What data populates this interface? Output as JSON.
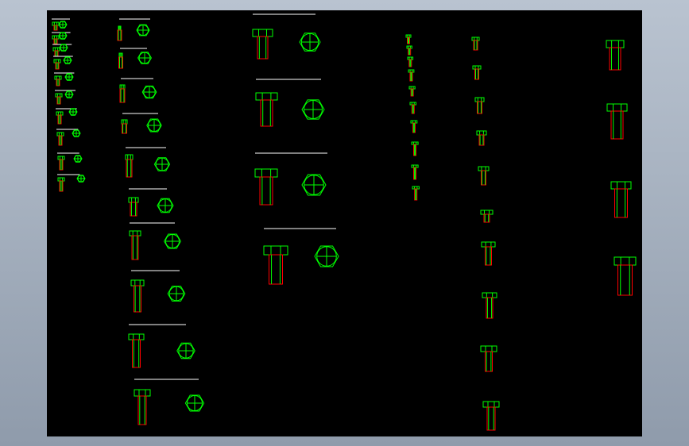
{
  "window": {
    "title": ""
  },
  "viewport": {
    "background": "#000000",
    "frame_gradient": [
      "#b9c3d0",
      "#8f9bab"
    ]
  },
  "drawing": {
    "colors": {
      "bolt_outline": "#00ff00",
      "shank_outline": "#ff0000",
      "title_line": "#ffffff",
      "center_mark": "#ffffff"
    }
  }
}
